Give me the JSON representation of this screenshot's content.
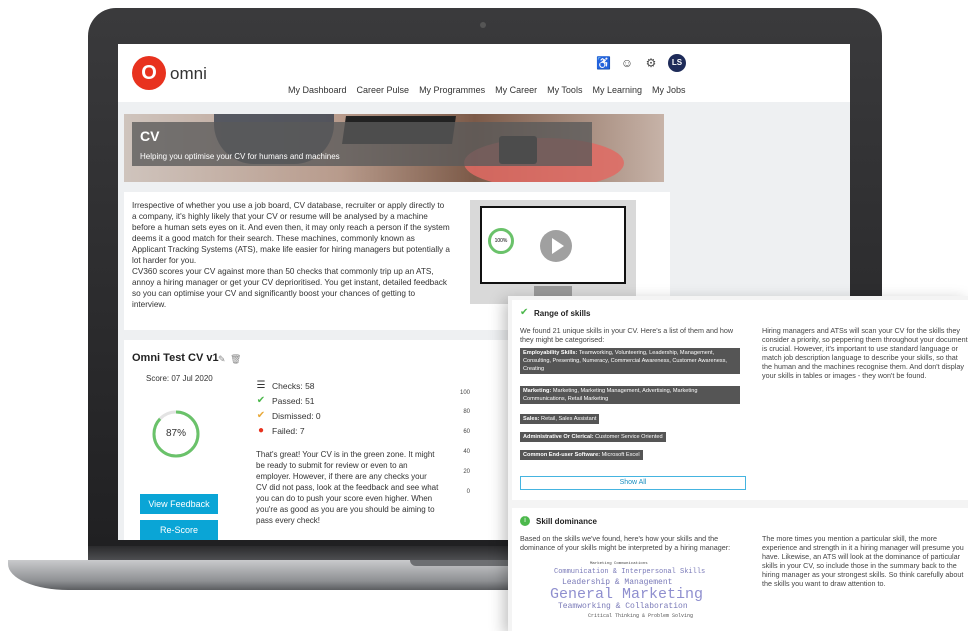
{
  "header": {
    "logo_mark": "O",
    "brand": "omni",
    "avatar": "LS"
  },
  "nav": [
    "My Dashboard",
    "Career Pulse",
    "My Programmes",
    "My Career",
    "My Tools",
    "My Learning",
    "My Jobs"
  ],
  "banner": {
    "title": "CV",
    "subtitle": "Helping you optimise your CV for humans and machines"
  },
  "intro": {
    "p1": "Irrespective of whether you use a job board, CV database, recruiter or apply directly to a company, it's highly likely that your CV or resume will be analysed by a machine before a human sets eyes on it. And even then, it may only reach a person if the system deems it a good match for their search. These machines, commonly known as Applicant Tracking Systems (ATS), make life easier for hiring managers but potentially a lot harder for you.",
    "p2": "CV360 scores your CV against more than 50 checks that commonly trip up an ATS, annoy a hiring manager or get your CV deprioritised. You get instant, detailed feedback so you can optimise your CV and significantly boost your chances of getting to interview."
  },
  "video": {
    "percent": "100%"
  },
  "score_card": {
    "title": "Omni Test CV v1",
    "score_date": "Score: 07 Jul 2020",
    "percent_label": "87%",
    "percent_value": 0.87,
    "view_feedback": "View Feedback",
    "rescore": "Re-Score",
    "checks": "Checks: 58",
    "passed": "Passed: 51",
    "dismissed": "Dismissed: 0",
    "failed": "Failed: 7",
    "message": "That's great! Your CV is in the green zone. It might be ready to submit for review or even to an employer. However, if there are any checks your CV did not pass, look at the feedback and see what you can do to push your score even higher. When you're as good as you are you should be aiming to pass every check!",
    "ticks": [
      "100",
      "80",
      "60",
      "40",
      "20",
      "0"
    ]
  },
  "skills": {
    "title": "Range of skills",
    "intro": "We found 21 unique skills in your CV. Here's a list of them and how they might be categorised:",
    "tags": [
      {
        "cat": "Employability Skills:",
        "text": "Teamworking, Volunteering, Leadership, Management, Consulting, Presenting, Numeracy, Commercial Awareness, Customer Awareness, Creating"
      },
      {
        "cat": "Marketing:",
        "text": "Marketing, Marketing Management, Advertising, Marketing Communications, Retail Marketing"
      },
      {
        "cat": "Sales:",
        "text": "Retail, Sales Assistant"
      },
      {
        "cat": "Administrative Or Clerical:",
        "text": "Customer Service Oriented"
      },
      {
        "cat": "Common End-user Software:",
        "text": "Microsoft Excel"
      }
    ],
    "show_all": "Show All",
    "side": "Hiring managers and ATSs will scan your CV for the skills they consider a priority, so peppering them throughout your document is crucial. However, it's important to use standard language or match job description language to describe your skills, so that the human and the machines recognise them. And don't display your skills in tables or images - they won't be found."
  },
  "dominance": {
    "title": "Skill dominance",
    "intro": "Based on the skills we've found, here's how your skills and the dominance of your skills might be interpreted by a hiring manager:",
    "side": "The more times you mention a particular skill, the more experience and strength in it a hiring manager will presume you have. Likewise, an ATS will look at the dominance of particular skills in your CV, so include those in the summary back to the hiring manager as your strongest skills. So think carefully about the skills you want to draw attention to.",
    "words": {
      "w1": "Marketing Communications",
      "w2": "Communication & Interpersonal Skills",
      "w3": "Leadership & Management",
      "w4": "General Marketing",
      "w5": "Teamworking & Collaboration",
      "w6": "Critical Thinking & Problem Solving"
    }
  }
}
